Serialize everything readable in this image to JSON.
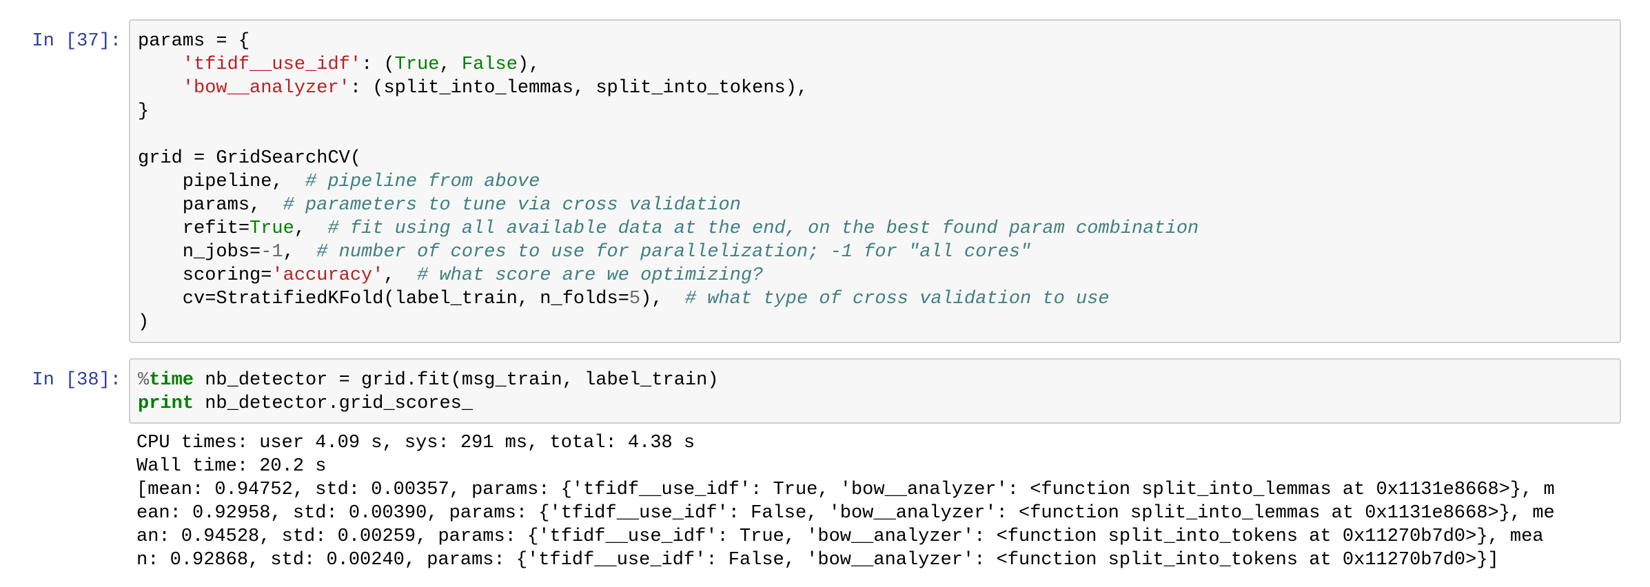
{
  "cells": [
    {
      "prompt": "In [37]:",
      "code": {
        "l1_a": "params = {",
        "l2_ind": "    ",
        "l2_s": "'tfidf__use_idf'",
        "l2_b": ": (",
        "l2_k1": "True",
        "l2_c": ", ",
        "l2_k2": "False",
        "l2_d": "),",
        "l3_ind": "    ",
        "l3_s": "'bow__analyzer'",
        "l3_b": ": (split_into_lemmas, split_into_tokens),",
        "l4": "}",
        "l6": "grid = GridSearchCV(",
        "l7_a": "    pipeline,  ",
        "l7_c": "# pipeline from above",
        "l8_a": "    params,  ",
        "l8_c": "# parameters to tune via cross validation",
        "l9_a": "    refit=",
        "l9_k": "True",
        "l9_b": ",  ",
        "l9_c": "# fit using all available data at the end, on the best found param combination",
        "l10_a": "    n_jobs=",
        "l10_m": "-1",
        "l10_b": ",  ",
        "l10_c": "# number of cores to use for parallelization; -1 for \"all cores\"",
        "l11_a": "    scoring=",
        "l11_s": "'accuracy'",
        "l11_b": ",  ",
        "l11_c": "# what score are we optimizing?",
        "l12_a": "    cv=StratifiedKFold(label_train, n_folds=",
        "l12_m": "5",
        "l12_b": "),  ",
        "l12_c": "# what type of cross validation to use",
        "l13": ")"
      }
    },
    {
      "prompt": "In [38]:",
      "code": {
        "l1_pct": "%",
        "l1_kw": "time",
        "l1_rest": " nb_detector = grid.fit(msg_train, label_train)",
        "l2_kw": "print",
        "l2_rest": " nb_detector.grid_scores_"
      },
      "output": [
        "CPU times: user 4.09 s, sys: 291 ms, total: 4.38 s",
        "Wall time: 20.2 s",
        "[mean: 0.94752, std: 0.00357, params: {'tfidf__use_idf': True, 'bow__analyzer': <function split_into_lemmas at 0x1131e8668>}, m",
        "ean: 0.92958, std: 0.00390, params: {'tfidf__use_idf': False, 'bow__analyzer': <function split_into_lemmas at 0x1131e8668>}, me",
        "an: 0.94528, std: 0.00259, params: {'tfidf__use_idf': True, 'bow__analyzer': <function split_into_tokens at 0x11270b7d0>}, mea",
        "n: 0.92868, std: 0.00240, params: {'tfidf__use_idf': False, 'bow__analyzer': <function split_into_tokens at 0x11270b7d0>}]"
      ]
    }
  ]
}
